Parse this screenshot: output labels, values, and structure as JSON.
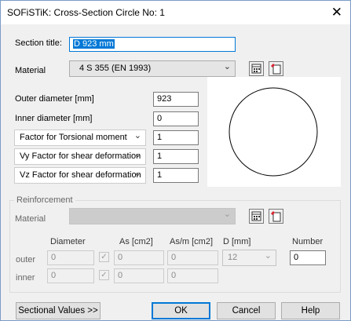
{
  "window": {
    "title": "SOFiSTiK: Cross-Section Circle No:   1",
    "close_glyph": "✕"
  },
  "section": {
    "title_label": "Section title:",
    "title_value": "D 923 mm"
  },
  "material": {
    "label": "Material",
    "value": "4 S 355 (EN 1993)"
  },
  "fields": {
    "outer_diameter_label": "Outer diameter [mm]",
    "outer_diameter_value": "923",
    "inner_diameter_label": "Inner diameter [mm]",
    "inner_diameter_value": "0",
    "torsional_label": "Factor for Torsional moment",
    "torsional_value": "1",
    "vy_label": "Vy Factor for shear deformation",
    "vy_value": "1",
    "vz_label": "Vz Factor for shear deformation",
    "vz_value": "1"
  },
  "reinforcement": {
    "group_label": "Reinforcement",
    "material_label": "Material",
    "material_value": "",
    "headers": {
      "diameter": "Diameter",
      "as": "As [cm2]",
      "asm": "As/m [cm2]",
      "d": "D [mm]",
      "number": "Number"
    },
    "rows": [
      {
        "label": "outer",
        "diameter": "0",
        "as": "0",
        "asm": "0",
        "d": "12",
        "number": "0"
      },
      {
        "label": "inner",
        "diameter": "0",
        "as": "0",
        "asm": "0"
      }
    ]
  },
  "buttons": {
    "sectional_values": "Sectional Values >>",
    "ok": "OK",
    "cancel": "Cancel",
    "help": "Help"
  },
  "colors": {
    "accent": "#0078d7",
    "dialog_bg": "#f0f0f0"
  }
}
